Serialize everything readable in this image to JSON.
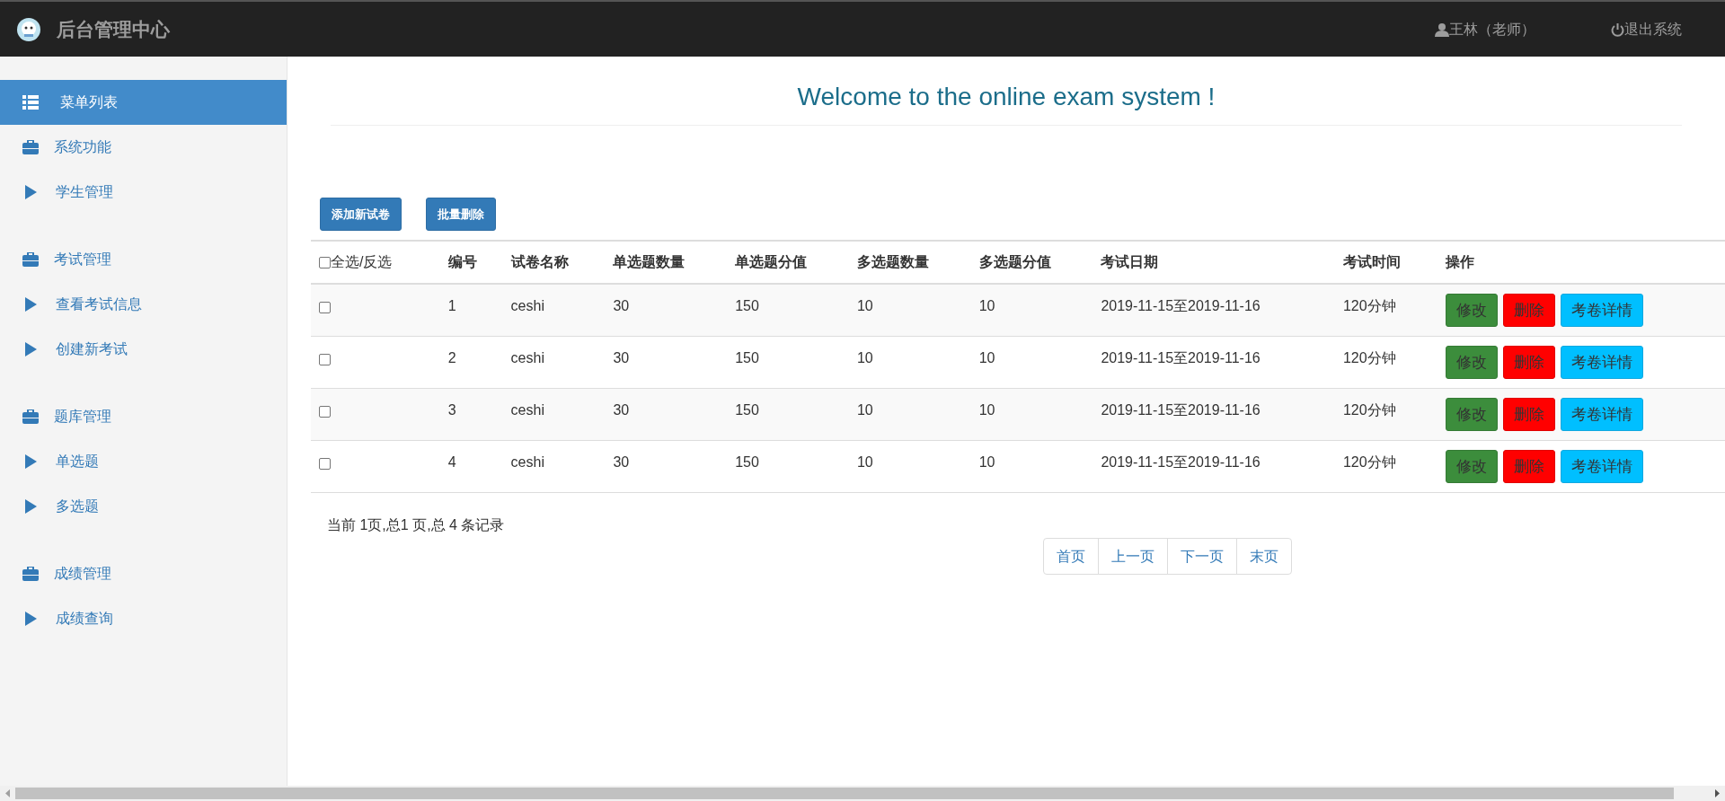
{
  "header": {
    "title": "后台管理中心",
    "user": "王林（老师）",
    "logout": "退出系统"
  },
  "sidebar": {
    "title": {
      "label": "菜单列表",
      "selected": true
    },
    "groups": [
      {
        "label": "系统功能",
        "items": [
          {
            "label": "学生管理",
            "selected": false
          }
        ]
      },
      {
        "label": "考试管理",
        "items": [
          {
            "label": "查看考试信息",
            "selected": false
          },
          {
            "label": "创建新考试",
            "selected": false
          }
        ]
      },
      {
        "label": "题库管理",
        "items": [
          {
            "label": "单选题",
            "selected": false
          },
          {
            "label": "多选题",
            "selected": false
          }
        ]
      },
      {
        "label": "成绩管理",
        "items": [
          {
            "label": "成绩查询",
            "selected": false
          }
        ]
      }
    ]
  },
  "welcome": "Welcome to the online exam system !",
  "toolbar": [
    "添加新试卷",
    "批量删除"
  ],
  "table": {
    "select_all": {
      "label": "全选/反选",
      "checked": false
    },
    "columns": [
      "编号",
      "试卷名称",
      "单选题数量",
      "单选题分值",
      "多选题数量",
      "多选题分值",
      "考试日期",
      "考试时间",
      "操作"
    ],
    "rows": [
      {
        "checked": false,
        "cells": [
          "1",
          "ceshi",
          "30",
          "150",
          "10",
          "10",
          "2019-11-15至2019-11-16",
          "120分钟"
        ],
        "actions": [
          {
            "kind": "edit",
            "label": "修改"
          },
          {
            "kind": "delete",
            "label": "删除"
          },
          {
            "kind": "details",
            "label": "考卷详情"
          }
        ]
      },
      {
        "checked": false,
        "cells": [
          "2",
          "ceshi",
          "30",
          "150",
          "10",
          "10",
          "2019-11-15至2019-11-16",
          "120分钟"
        ],
        "actions": [
          {
            "kind": "edit",
            "label": "修改"
          },
          {
            "kind": "delete",
            "label": "删除"
          },
          {
            "kind": "details",
            "label": "考卷详情"
          }
        ]
      },
      {
        "checked": false,
        "cells": [
          "3",
          "ceshi",
          "30",
          "150",
          "10",
          "10",
          "2019-11-15至2019-11-16",
          "120分钟"
        ],
        "actions": [
          {
            "kind": "edit",
            "label": "修改"
          },
          {
            "kind": "delete",
            "label": "删除"
          },
          {
            "kind": "details",
            "label": "考卷详情"
          }
        ]
      },
      {
        "checked": false,
        "cells": [
          "4",
          "ceshi",
          "30",
          "150",
          "10",
          "10",
          "2019-11-15至2019-11-16",
          "120分钟"
        ],
        "actions": [
          {
            "kind": "edit",
            "label": "修改"
          },
          {
            "kind": "delete",
            "label": "删除"
          },
          {
            "kind": "details",
            "label": "考卷详情"
          }
        ]
      }
    ]
  },
  "pagination": {
    "summary": "当前 1页,总1 页,总 4 条记录",
    "links": [
      "首页",
      "上一页",
      "下一页",
      "末页"
    ]
  }
}
